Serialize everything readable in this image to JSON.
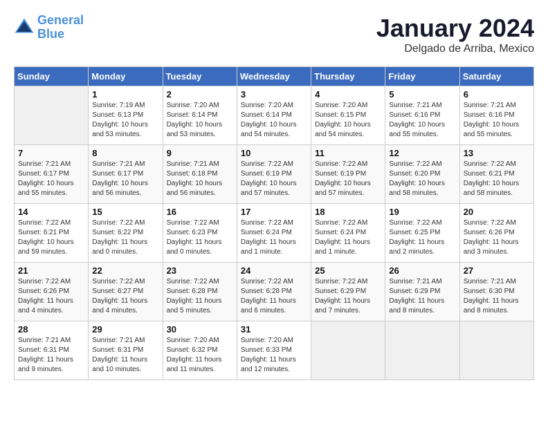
{
  "header": {
    "logo_line1": "General",
    "logo_line2": "Blue",
    "month_title": "January 2024",
    "location": "Delgado de Arriba, Mexico"
  },
  "days_of_week": [
    "Sunday",
    "Monday",
    "Tuesday",
    "Wednesday",
    "Thursday",
    "Friday",
    "Saturday"
  ],
  "weeks": [
    [
      {
        "day": "",
        "info": ""
      },
      {
        "day": "1",
        "info": "Sunrise: 7:19 AM\nSunset: 6:13 PM\nDaylight: 10 hours\nand 53 minutes."
      },
      {
        "day": "2",
        "info": "Sunrise: 7:20 AM\nSunset: 6:14 PM\nDaylight: 10 hours\nand 53 minutes."
      },
      {
        "day": "3",
        "info": "Sunrise: 7:20 AM\nSunset: 6:14 PM\nDaylight: 10 hours\nand 54 minutes."
      },
      {
        "day": "4",
        "info": "Sunrise: 7:20 AM\nSunset: 6:15 PM\nDaylight: 10 hours\nand 54 minutes."
      },
      {
        "day": "5",
        "info": "Sunrise: 7:21 AM\nSunset: 6:16 PM\nDaylight: 10 hours\nand 55 minutes."
      },
      {
        "day": "6",
        "info": "Sunrise: 7:21 AM\nSunset: 6:16 PM\nDaylight: 10 hours\nand 55 minutes."
      }
    ],
    [
      {
        "day": "7",
        "info": "Sunrise: 7:21 AM\nSunset: 6:17 PM\nDaylight: 10 hours\nand 55 minutes."
      },
      {
        "day": "8",
        "info": "Sunrise: 7:21 AM\nSunset: 6:17 PM\nDaylight: 10 hours\nand 56 minutes."
      },
      {
        "day": "9",
        "info": "Sunrise: 7:21 AM\nSunset: 6:18 PM\nDaylight: 10 hours\nand 56 minutes."
      },
      {
        "day": "10",
        "info": "Sunrise: 7:22 AM\nSunset: 6:19 PM\nDaylight: 10 hours\nand 57 minutes."
      },
      {
        "day": "11",
        "info": "Sunrise: 7:22 AM\nSunset: 6:19 PM\nDaylight: 10 hours\nand 57 minutes."
      },
      {
        "day": "12",
        "info": "Sunrise: 7:22 AM\nSunset: 6:20 PM\nDaylight: 10 hours\nand 58 minutes."
      },
      {
        "day": "13",
        "info": "Sunrise: 7:22 AM\nSunset: 6:21 PM\nDaylight: 10 hours\nand 58 minutes."
      }
    ],
    [
      {
        "day": "14",
        "info": "Sunrise: 7:22 AM\nSunset: 6:21 PM\nDaylight: 10 hours\nand 59 minutes."
      },
      {
        "day": "15",
        "info": "Sunrise: 7:22 AM\nSunset: 6:22 PM\nDaylight: 11 hours\nand 0 minutes."
      },
      {
        "day": "16",
        "info": "Sunrise: 7:22 AM\nSunset: 6:23 PM\nDaylight: 11 hours\nand 0 minutes."
      },
      {
        "day": "17",
        "info": "Sunrise: 7:22 AM\nSunset: 6:24 PM\nDaylight: 11 hours\nand 1 minute."
      },
      {
        "day": "18",
        "info": "Sunrise: 7:22 AM\nSunset: 6:24 PM\nDaylight: 11 hours\nand 1 minute."
      },
      {
        "day": "19",
        "info": "Sunrise: 7:22 AM\nSunset: 6:25 PM\nDaylight: 11 hours\nand 2 minutes."
      },
      {
        "day": "20",
        "info": "Sunrise: 7:22 AM\nSunset: 6:26 PM\nDaylight: 11 hours\nand 3 minutes."
      }
    ],
    [
      {
        "day": "21",
        "info": "Sunrise: 7:22 AM\nSunset: 6:26 PM\nDaylight: 11 hours\nand 4 minutes."
      },
      {
        "day": "22",
        "info": "Sunrise: 7:22 AM\nSunset: 6:27 PM\nDaylight: 11 hours\nand 4 minutes."
      },
      {
        "day": "23",
        "info": "Sunrise: 7:22 AM\nSunset: 6:28 PM\nDaylight: 11 hours\nand 5 minutes."
      },
      {
        "day": "24",
        "info": "Sunrise: 7:22 AM\nSunset: 6:28 PM\nDaylight: 11 hours\nand 6 minutes."
      },
      {
        "day": "25",
        "info": "Sunrise: 7:22 AM\nSunset: 6:29 PM\nDaylight: 11 hours\nand 7 minutes."
      },
      {
        "day": "26",
        "info": "Sunrise: 7:21 AM\nSunset: 6:29 PM\nDaylight: 11 hours\nand 8 minutes."
      },
      {
        "day": "27",
        "info": "Sunrise: 7:21 AM\nSunset: 6:30 PM\nDaylight: 11 hours\nand 8 minutes."
      }
    ],
    [
      {
        "day": "28",
        "info": "Sunrise: 7:21 AM\nSunset: 6:31 PM\nDaylight: 11 hours\nand 9 minutes."
      },
      {
        "day": "29",
        "info": "Sunrise: 7:21 AM\nSunset: 6:31 PM\nDaylight: 11 hours\nand 10 minutes."
      },
      {
        "day": "30",
        "info": "Sunrise: 7:20 AM\nSunset: 6:32 PM\nDaylight: 11 hours\nand 11 minutes."
      },
      {
        "day": "31",
        "info": "Sunrise: 7:20 AM\nSunset: 6:33 PM\nDaylight: 11 hours\nand 12 minutes."
      },
      {
        "day": "",
        "info": ""
      },
      {
        "day": "",
        "info": ""
      },
      {
        "day": "",
        "info": ""
      }
    ]
  ]
}
